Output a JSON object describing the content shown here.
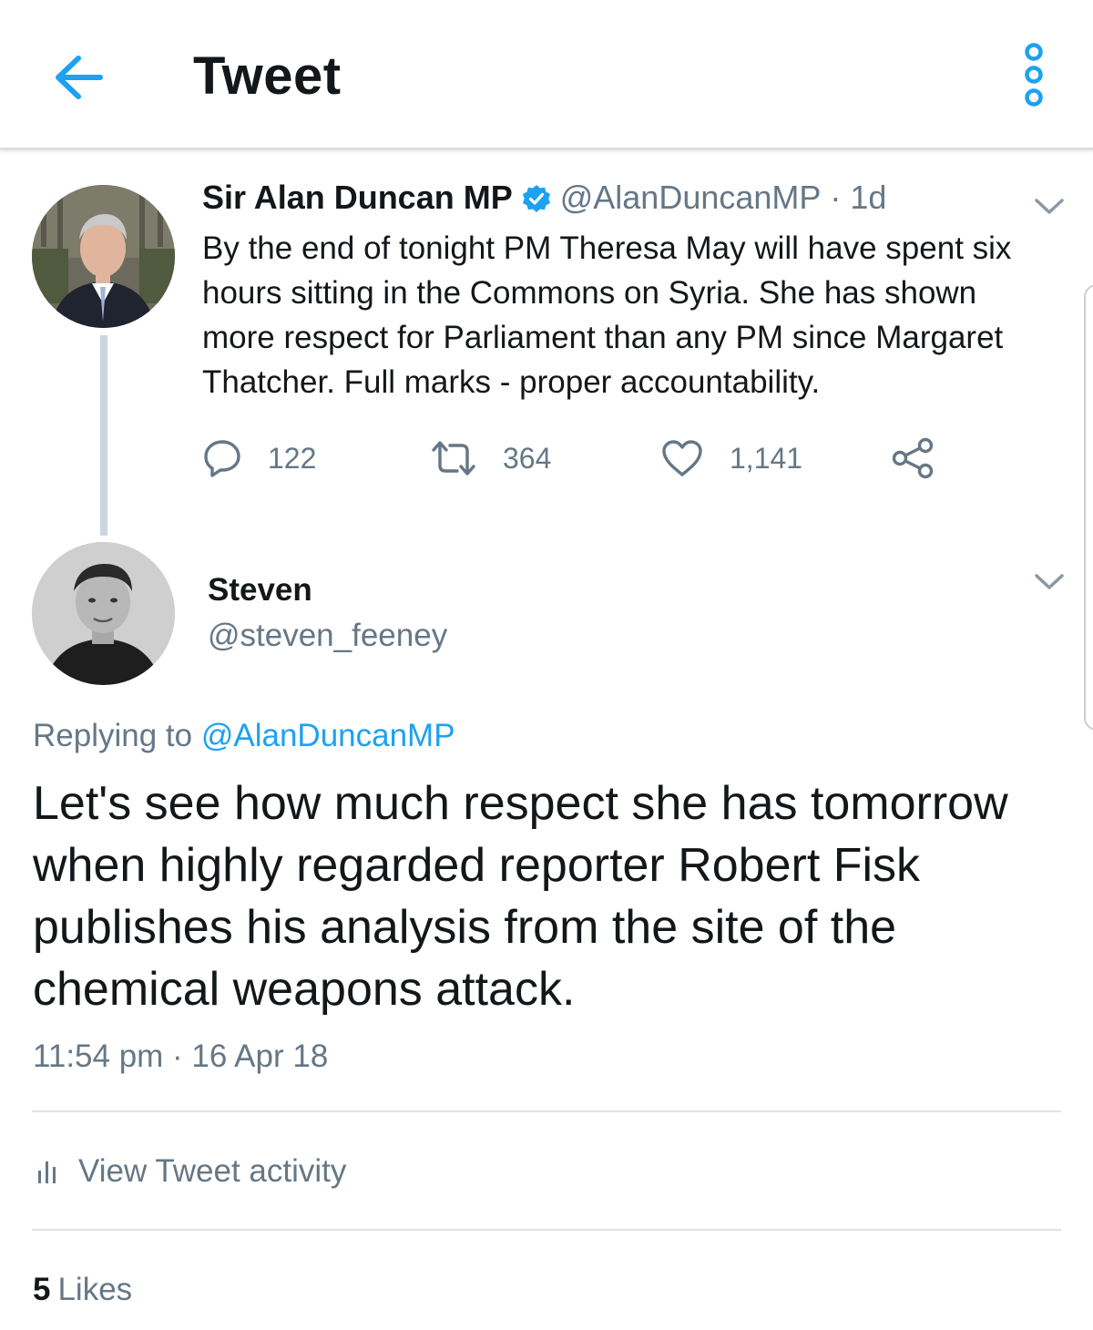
{
  "header": {
    "title": "Tweet",
    "back_icon": "back-arrow-icon",
    "more_icon": "more-options-icon",
    "accent_color": "#1da1f2"
  },
  "parent_tweet": {
    "name": "Sir Alan Duncan MP",
    "verified": true,
    "handle": "@AlanDuncanMP",
    "separator": "·",
    "time": "1d",
    "text": "By the end of tonight PM Theresa May will have spent six hours sitting in the Commons on Syria.  She has shown more respect for Parliament than any PM since Margaret Thatcher. Full marks - proper accountability.",
    "actions": {
      "replies": "122",
      "retweets": "364",
      "likes": "1,141"
    }
  },
  "reply_tweet": {
    "name": "Steven",
    "handle": "@steven_feeney",
    "replying_prefix": "Replying to",
    "replying_handle": "@AlanDuncanMP",
    "text": "Let's see how much respect she has tomorrow when highly regarded reporter Robert Fisk publishes his analysis from the site of the chemical weapons attack.",
    "timestamp": "11:54 pm · 16 Apr 18"
  },
  "activity": {
    "label": "View Tweet activity",
    "icon": "bar-chart-icon"
  },
  "likes": {
    "count": "5",
    "label": "Likes"
  }
}
